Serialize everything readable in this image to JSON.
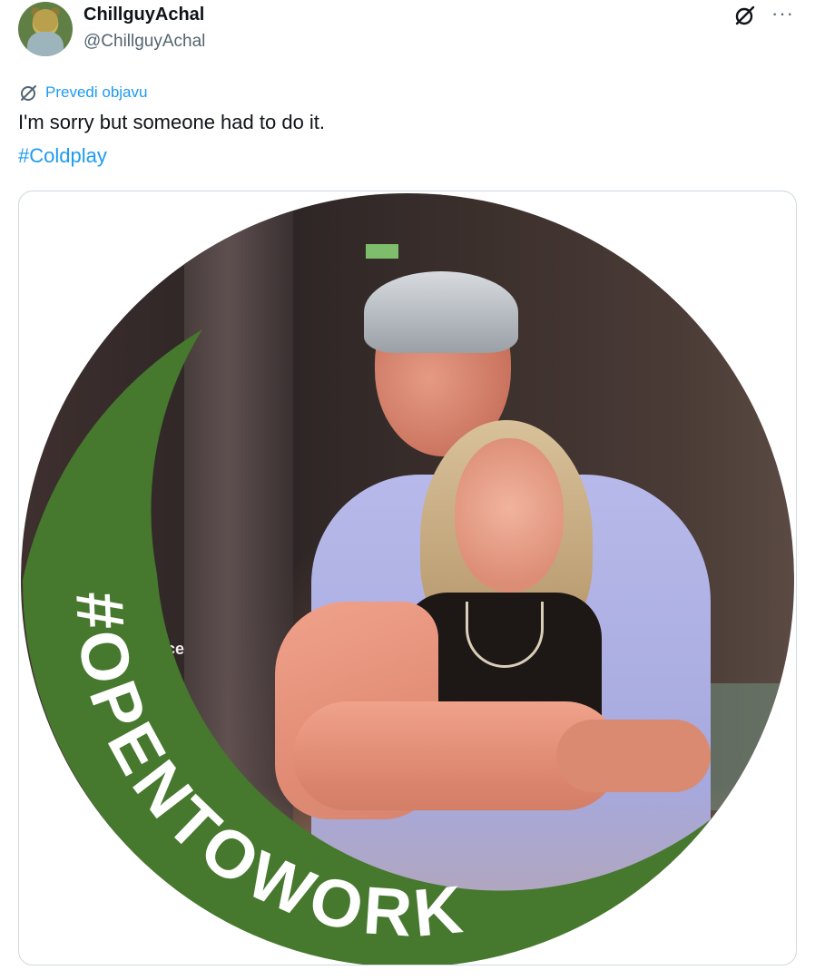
{
  "tweet": {
    "author": {
      "display_name": "ChillguyAchal",
      "handle": "@ChillguyAchal",
      "avatar_icon": "chill-guy-avatar"
    },
    "header_icons": [
      "grok-icon",
      "more-options-icon"
    ],
    "more_glyph": "···",
    "translate_label": "Prevedi objavu",
    "text": "I'm sorry but someone had to do it.",
    "hashtag": "#Coldplay"
  },
  "media": {
    "frame_text": "#OPENTOWORK",
    "frame_color": "#46782e",
    "screen_partial_text": "ace"
  },
  "colors": {
    "link": "#1d9bf0",
    "secondary_text": "#536471",
    "primary_text": "#0f1419",
    "card_border": "#cfd9de"
  }
}
